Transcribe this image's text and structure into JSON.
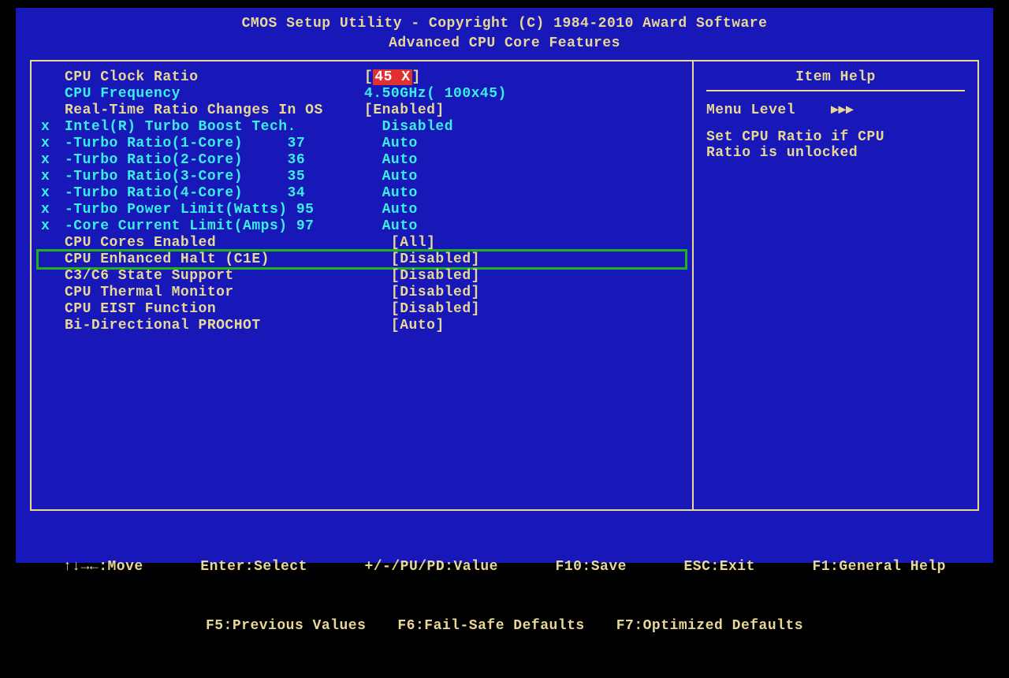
{
  "header": {
    "line1": "CMOS Setup Utility - Copyright (C) 1984-2010 Award Software",
    "line2": "Advanced CPU Core Features"
  },
  "settings": [
    {
      "prefix": " ",
      "label": "CPU Clock Ratio",
      "value_pre": "[",
      "value_mid": "45 X",
      "value_post": "]",
      "style": "yellow",
      "highlight": true,
      "box": false
    },
    {
      "prefix": " ",
      "label": "CPU Frequency",
      "value_pre": "",
      "value_mid": "4.50GHz( 100x45)",
      "value_post": "",
      "style": "cyan",
      "highlight": false,
      "box": false
    },
    {
      "prefix": " ",
      "label": "Real-Time Ratio Changes In OS",
      "value_pre": "[",
      "value_mid": "Enabled",
      "value_post": "]",
      "style": "yellow",
      "highlight": false,
      "box": false
    },
    {
      "prefix": "x",
      "label": "Intel(R) Turbo Boost Tech.",
      "value_pre": "",
      "value_mid": "  Disabled",
      "value_post": "",
      "style": "cyan",
      "highlight": false,
      "box": false
    },
    {
      "prefix": "x",
      "label": "-Turbo Ratio(1-Core)     37",
      "value_pre": "",
      "value_mid": "  Auto",
      "value_post": "",
      "style": "cyan",
      "highlight": false,
      "box": false
    },
    {
      "prefix": "x",
      "label": "-Turbo Ratio(2-Core)     36",
      "value_pre": "",
      "value_mid": "  Auto",
      "value_post": "",
      "style": "cyan",
      "highlight": false,
      "box": false
    },
    {
      "prefix": "x",
      "label": "-Turbo Ratio(3-Core)     35",
      "value_pre": "",
      "value_mid": "  Auto",
      "value_post": "",
      "style": "cyan",
      "highlight": false,
      "box": false
    },
    {
      "prefix": "x",
      "label": "-Turbo Ratio(4-Core)     34",
      "value_pre": "",
      "value_mid": "  Auto",
      "value_post": "",
      "style": "cyan",
      "highlight": false,
      "box": false
    },
    {
      "prefix": "x",
      "label": "-Turbo Power Limit(Watts) 95",
      "value_pre": "",
      "value_mid": "  Auto",
      "value_post": "",
      "style": "cyan",
      "highlight": false,
      "box": false
    },
    {
      "prefix": "x",
      "label": "-Core Current Limit(Amps) 97",
      "value_pre": "",
      "value_mid": "  Auto",
      "value_post": "",
      "style": "cyan",
      "highlight": false,
      "box": false
    },
    {
      "prefix": " ",
      "label": "CPU Cores Enabled",
      "value_pre": "   [",
      "value_mid": "All",
      "value_post": "]",
      "style": "yellow",
      "highlight": false,
      "box": false
    },
    {
      "prefix": " ",
      "label": "CPU Enhanced Halt (C1E)",
      "value_pre": "   [",
      "value_mid": "Disabled",
      "value_post": "]",
      "style": "yellow",
      "highlight": false,
      "box": true
    },
    {
      "prefix": " ",
      "label": "C3/C6 State Support",
      "value_pre": "   [",
      "value_mid": "Disabled",
      "value_post": "]",
      "style": "yellow",
      "highlight": false,
      "box": false
    },
    {
      "prefix": " ",
      "label": "CPU Thermal Monitor",
      "value_pre": "   [",
      "value_mid": "Disabled",
      "value_post": "]",
      "style": "yellow",
      "highlight": false,
      "box": false
    },
    {
      "prefix": " ",
      "label": "CPU EIST Function",
      "value_pre": "   [",
      "value_mid": "Disabled",
      "value_post": "]",
      "style": "yellow",
      "highlight": false,
      "box": false
    },
    {
      "prefix": " ",
      "label": "Bi-Directional PROCHOT",
      "value_pre": "   [",
      "value_mid": "Auto",
      "value_post": "]",
      "style": "yellow",
      "highlight": false,
      "box": false
    }
  ],
  "help": {
    "title": "Item Help",
    "menu_level": "Menu Level    ▸▸▸",
    "body1": "Set CPU Ratio if CPU",
    "body2": "Ratio is unlocked"
  },
  "footer": {
    "l1a": "↑↓→←:Move",
    "l1b": "Enter:Select",
    "l1c": "+/-/PU/PD:Value",
    "l1d": "F10:Save",
    "l1e": "ESC:Exit",
    "l1f": "F1:General Help",
    "l2a": "F5:Previous Values",
    "l2b": "F6:Fail-Safe Defaults",
    "l2c": "F7:Optimized Defaults"
  }
}
